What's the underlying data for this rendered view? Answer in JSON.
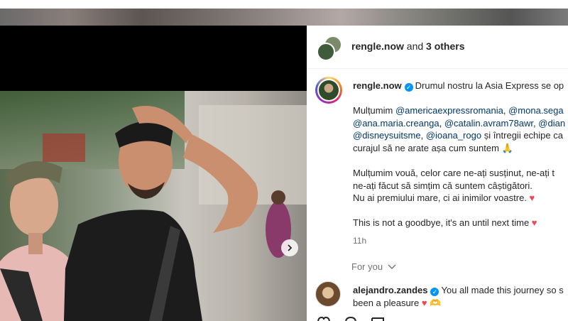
{
  "header": {
    "username": "rengle.now",
    "and_text": " and ",
    "others": "3 others"
  },
  "caption": {
    "username": "rengle.now",
    "line1": "Drumul nostru la Asia Express se op",
    "thanks_prefix": "Mulțumim ",
    "tags_row1": [
      "@americaexpressromania",
      "@mona.sega"
    ],
    "tags_row2": [
      "@ana.maria.creanga",
      "@catalin.avram78awr",
      "@dian"
    ],
    "tags_row3": [
      "@disneysuitsme",
      "@ioana_rogo"
    ],
    "row3_suffix": " și întregii echipe ca",
    "line4": "curajul să ne arate așa cum suntem",
    "para2_line1": "Mulțumim vouă, celor care ne-ați susținut, ne-ați t",
    "para2_line2": "ne-ați făcut să simțim că suntem câștigători.",
    "para2_line3": "Nu ai premiului mare, ci ai inimilor voastre.",
    "para3": "This is not a goodbye, it's an until next time",
    "time": "11h"
  },
  "for_you": "For you",
  "comment": {
    "username": "alejandro.zandes",
    "line1": "You all made this journey so s",
    "line2": "been a pleasure"
  },
  "icons": {
    "next": "chevron-right-icon",
    "verified": "verified-badge-icon",
    "heart": "heart-emoji",
    "pray": "praying-hands-emoji",
    "hands_heart": "heart-hands-emoji"
  },
  "colors": {
    "link": "#00376b",
    "verified": "#0095f6",
    "heart": "#ed4956",
    "muted": "#737373"
  }
}
